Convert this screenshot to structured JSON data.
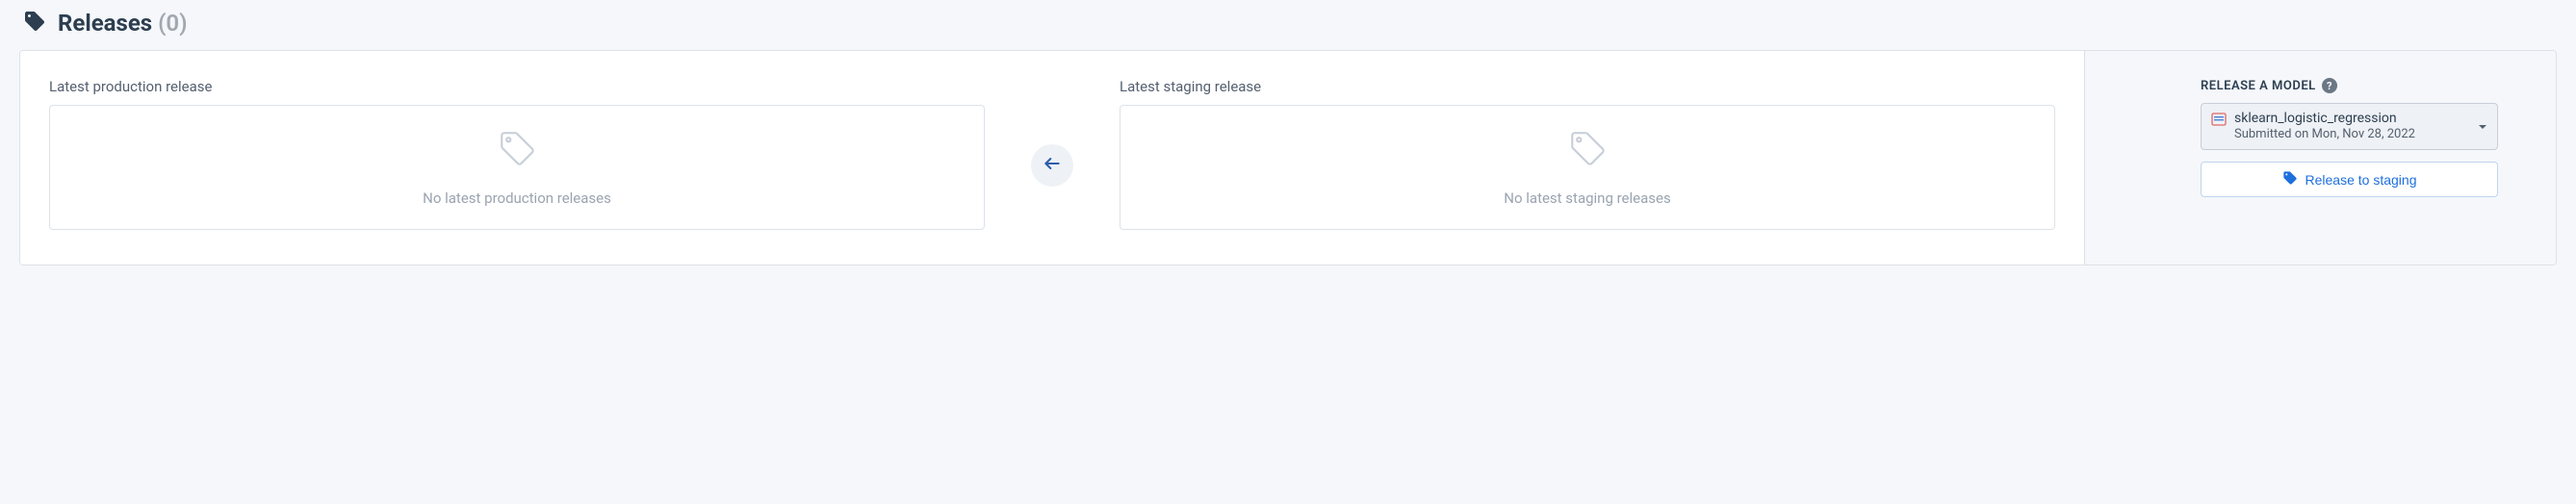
{
  "header": {
    "title": "Releases",
    "count": "(0)"
  },
  "production": {
    "label": "Latest production release",
    "empty": "No latest production releases"
  },
  "staging": {
    "label": "Latest staging release",
    "empty": "No latest staging releases"
  },
  "sidebar": {
    "release_model_label": "RELEASE A MODEL",
    "model_name": "sklearn_logistic_regression",
    "submitted": "Submitted on Mon, Nov 28, 2022",
    "release_button": "Release to staging"
  }
}
